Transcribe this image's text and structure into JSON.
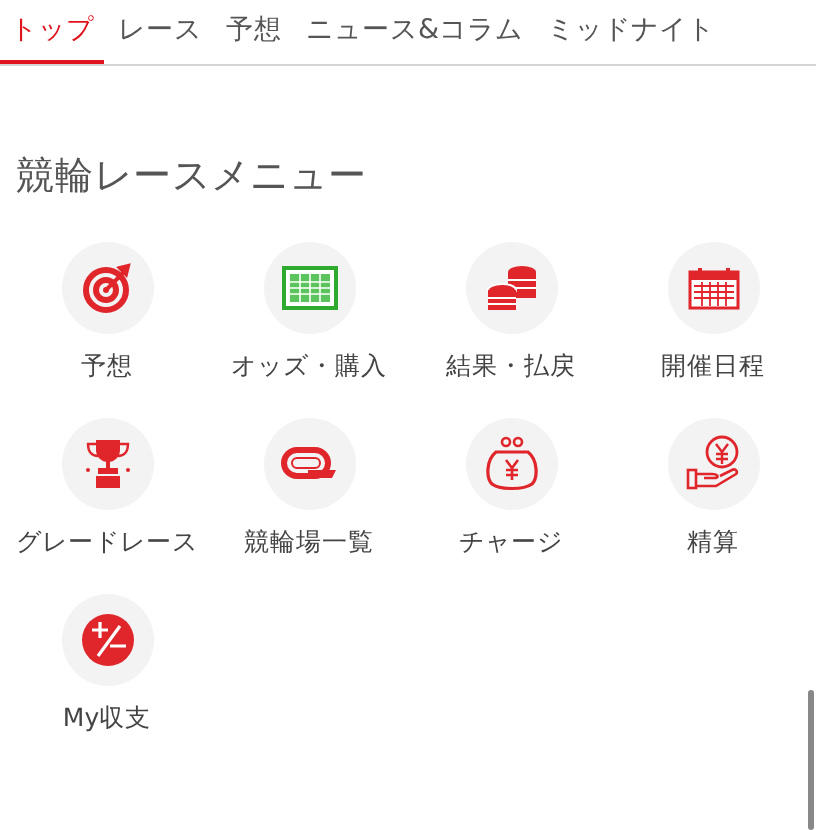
{
  "tabs": [
    {
      "label": "トップ",
      "selected": true
    },
    {
      "label": "レース",
      "selected": false
    },
    {
      "label": "予想",
      "selected": false
    },
    {
      "label": "ニュース&コラム",
      "selected": false
    },
    {
      "label": "ミッドナイト",
      "selected": false
    }
  ],
  "menu": {
    "title": "競輪レースメニュー",
    "items": [
      {
        "label": "予想",
        "kind": "target"
      },
      {
        "label": "オッズ・購入",
        "kind": "table"
      },
      {
        "label": "結果・払戻",
        "kind": "coins"
      },
      {
        "label": "開催日程",
        "kind": "calendar"
      },
      {
        "label": "グレードレース",
        "kind": "trophy"
      },
      {
        "label": "競輪場一覧",
        "kind": "track"
      },
      {
        "label": "チャージ",
        "kind": "purse"
      },
      {
        "label": "精算",
        "kind": "hand"
      },
      {
        "label": "My収支",
        "kind": "plusminus"
      }
    ]
  }
}
